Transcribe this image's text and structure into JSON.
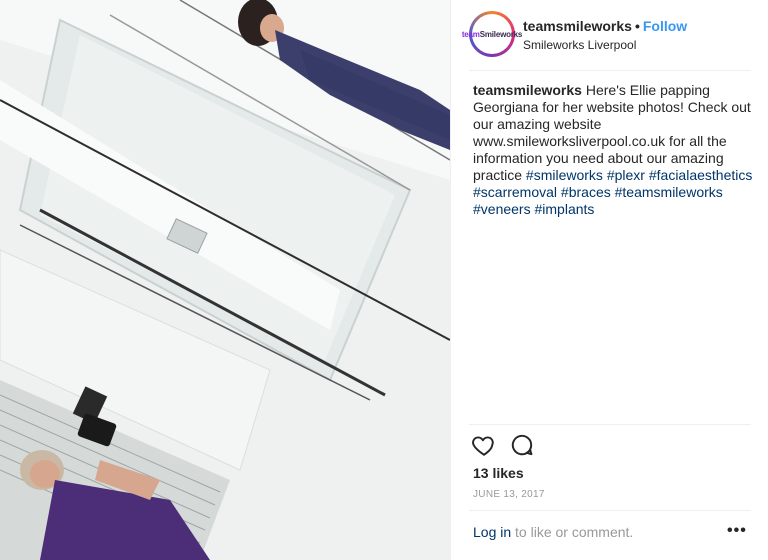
{
  "header": {
    "avatar_text_a": "team",
    "avatar_text_b": "Smileworks",
    "username": "teamsmileworks",
    "separator": "•",
    "follow_label": "Follow",
    "location": "Smileworks Liverpool"
  },
  "caption": {
    "username": "teamsmileworks",
    "text": " Here's Ellie papping Georgiana for her website photos! Check out our amazing website www.smileworksliverpool.co.uk for all the information you need about our amazing practice ",
    "hashtags": [
      "#smileworks",
      "#plexr",
      "#facialaesthetics",
      "#scarremoval",
      "#braces",
      "#teamsmileworks",
      "#veneers",
      "#implants"
    ]
  },
  "actions": {
    "like_icon": "heart-icon",
    "comment_icon": "comment-icon"
  },
  "likes_label": "13 likes",
  "date": "JUNE 13, 2017",
  "comment": {
    "login_label": "Log in",
    "rest": " to like or comment.",
    "more_label": "•••"
  }
}
